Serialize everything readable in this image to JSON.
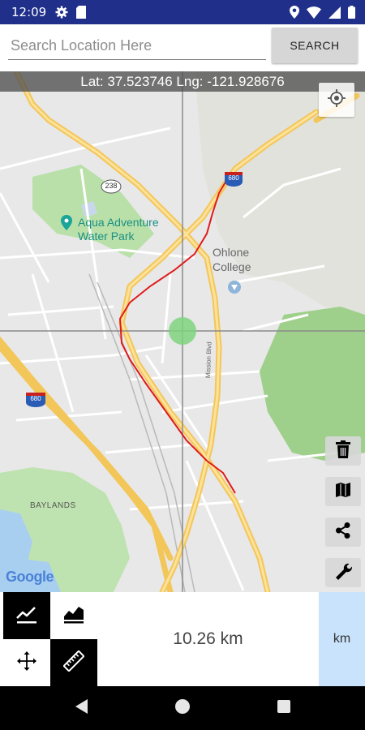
{
  "status_bar": {
    "time": "12:09",
    "left_icons": [
      "gear-icon",
      "sim-card-icon"
    ],
    "right_icons": [
      "location-icon",
      "wifi-icon",
      "signal-icon",
      "battery-icon"
    ]
  },
  "search": {
    "placeholder": "Search Location Here",
    "value": "",
    "button_label": "SEARCH"
  },
  "map": {
    "coordinates_text": "Lat: 37.523746 Lng: -121.928676",
    "labels": {
      "park": "Aqua Adventure Water Park",
      "park_line1": "Aqua Adventure",
      "park_line2": "Water Park",
      "college_line1": "Ohlone",
      "college_line2": "College",
      "baylands": "BAYLANDS",
      "road": "Mission Blvd",
      "shield_238": "238",
      "shield_680_top": "680",
      "shield_680_left": "680",
      "google": "Google"
    },
    "right_tools": [
      "delete-icon",
      "map-layers-icon",
      "share-icon",
      "settings-wrench-icon"
    ],
    "colors": {
      "route": "#e01a1a",
      "highway": "#f7d27a",
      "park": "#a8d89a",
      "water": "#9fc6ea",
      "marker": "#7fd37f"
    }
  },
  "bottom": {
    "distance": "10.26 km",
    "unit": "km",
    "modes": [
      "line-chart-mode",
      "area-chart-mode",
      "pan-mode",
      "ruler-mode"
    ],
    "active_modes": [
      "line-chart-mode",
      "ruler-mode"
    ]
  },
  "nav": {
    "buttons": [
      "back",
      "home",
      "recents"
    ]
  }
}
